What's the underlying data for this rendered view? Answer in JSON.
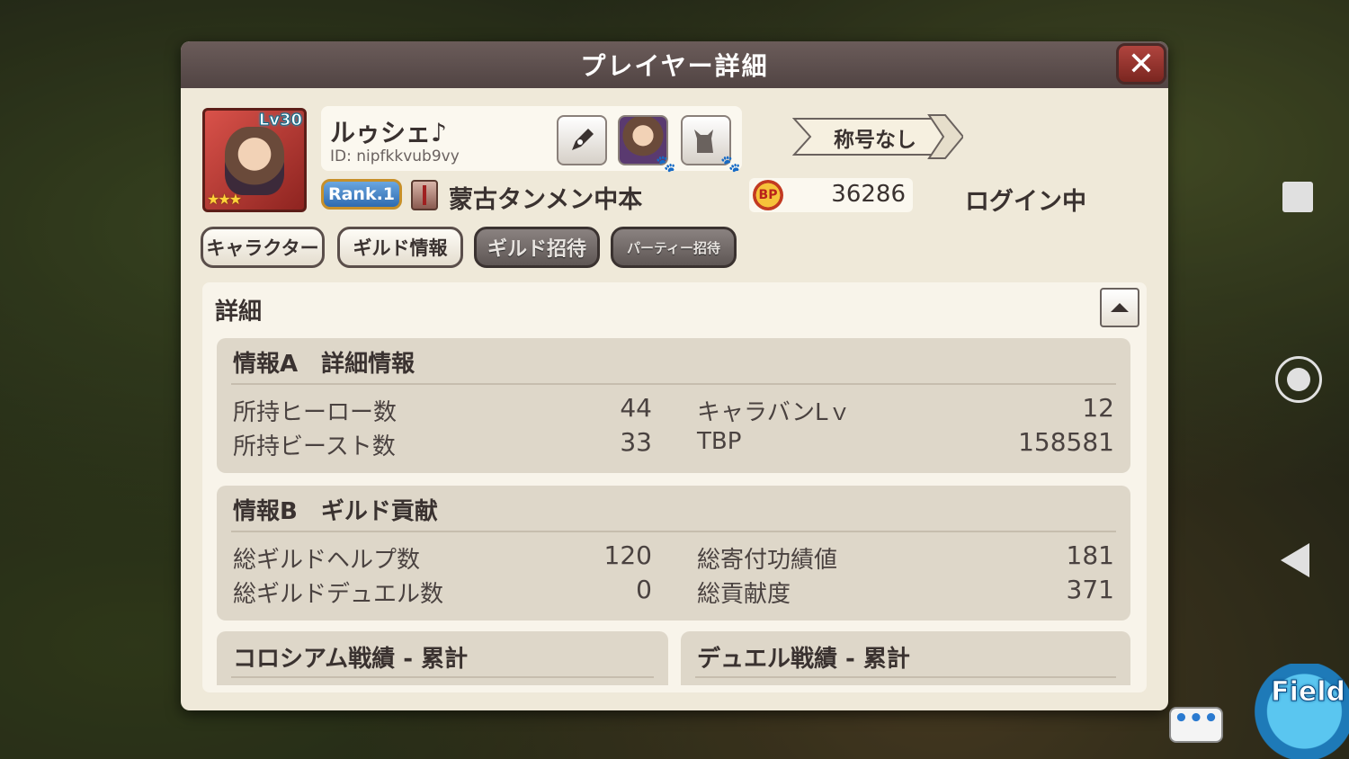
{
  "dialog": {
    "title": "プレイヤー詳細",
    "close_label": "✕"
  },
  "player": {
    "level": "Lv30",
    "stars": "★★★",
    "name": "ルゥシェ♪",
    "id": "ID: nipfkkvub9vy",
    "rank": "Rank.1",
    "guild_name": "蒙古タンメン中本",
    "bp_icon": "BP",
    "bp_value": "36286",
    "title_tag": "称号なし",
    "status": "ログイン中"
  },
  "tabs": {
    "character": "キャラクター",
    "guild_info": "ギルド情報",
    "guild_invite": "ギルド招待",
    "party_invite": "パーティー招待"
  },
  "details": {
    "title": "詳細",
    "collapse_icon": "︿",
    "section_a": {
      "header": "情報A　詳細情報",
      "rows": [
        {
          "label": "所持ヒーロー数",
          "value": "44"
        },
        {
          "label": "所持ビースト数",
          "value": "33"
        },
        {
          "label": "キャラバンLｖ",
          "value": "12"
        },
        {
          "label": "TBP",
          "value": "158581"
        }
      ]
    },
    "section_b": {
      "header": "情報B　ギルド貢献",
      "rows": [
        {
          "label": "総ギルドヘルプ数",
          "value": "120"
        },
        {
          "label": "総ギルドデュエル数",
          "value": "0"
        },
        {
          "label": "総寄付功績値",
          "value": "181"
        },
        {
          "label": "総貢献度",
          "value": "371"
        }
      ]
    },
    "colosseum_header": "コロシアム戦績 - 累計",
    "duel_header": "デュエル戦績 - 累計"
  },
  "overlay": {
    "chat_label": "•••",
    "field_label": "Field"
  },
  "icons": {
    "pen": "pen-icon",
    "pet_cat": "cat-icon",
    "hero_avatar": "hero-avatar-icon"
  }
}
